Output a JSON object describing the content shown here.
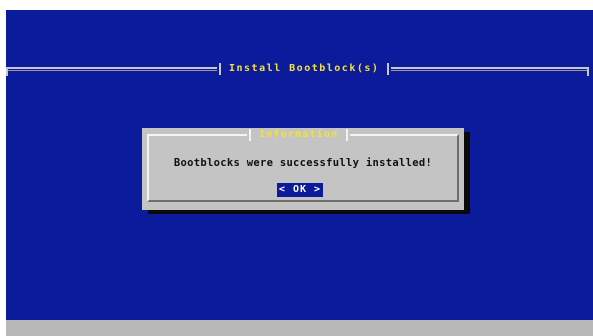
{
  "screen": {
    "title": "Install Bootblock(s)"
  },
  "dialog": {
    "title": "Information",
    "message": "Bootblocks were successfully installed!",
    "ok_button": {
      "left_arrow": "<",
      "label": "OK",
      "right_arrow": ">"
    }
  },
  "colors": {
    "background": "#0c1a9c",
    "title_text": "#f2e23a",
    "dialog_bg": "#c4c4c4",
    "bottom_bar": "#b8b8b8"
  }
}
